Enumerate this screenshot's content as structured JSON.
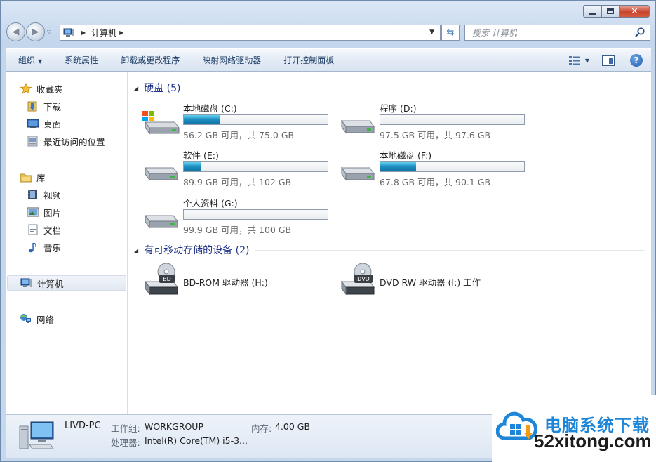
{
  "window": {
    "close_glyph": "✕"
  },
  "address": {
    "crumb": "计算机"
  },
  "search": {
    "placeholder": "搜索 计算机"
  },
  "toolbar": {
    "items": [
      "组织",
      "系统属性",
      "卸载或更改程序",
      "映射网络驱动器",
      "打开控制面板"
    ]
  },
  "sidebar": {
    "favorites": "收藏夹",
    "downloads": "下载",
    "desktop": "桌面",
    "recent": "最近访问的位置",
    "libraries": "库",
    "videos": "视频",
    "pictures": "图片",
    "documents": "文档",
    "music": "音乐",
    "computer": "计算机",
    "network": "网络"
  },
  "groups": {
    "hard_disks": "硬盘 (5)",
    "removable": "有可移动存储的设备 (2)"
  },
  "drives": [
    {
      "name": "本地磁盘 (C:)",
      "info": "56.2 GB 可用，共 75.0 GB",
      "used_fraction": 0.25,
      "system": true
    },
    {
      "name": "程序 (D:)",
      "info": "97.5 GB 可用，共 97.6 GB",
      "used_fraction": 0.001,
      "system": false
    },
    {
      "name": "软件 (E:)",
      "info": "89.9 GB 可用，共 102 GB",
      "used_fraction": 0.12,
      "system": false
    },
    {
      "name": "本地磁盘 (F:)",
      "info": "67.8 GB 可用，共 90.1 GB",
      "used_fraction": 0.25,
      "system": false
    },
    {
      "name": "个人资料 (G:)",
      "info": "99.9 GB 可用，共 100 GB",
      "used_fraction": 0.001,
      "system": false
    }
  ],
  "removable": [
    {
      "name": "BD-ROM 驱动器 (H:)",
      "badge": "BD"
    },
    {
      "name": "DVD RW 驱动器 (I:) 工作",
      "badge": "DVD"
    }
  ],
  "details": {
    "pc_name": "LIVD-PC",
    "workgroup_label": "工作组:",
    "workgroup": "WORKGROUP",
    "memory_label": "内存:",
    "memory": "4.00 GB",
    "cpu_label": "处理器:",
    "cpu": "Intel(R) Core(TM) i5-3..."
  },
  "watermark": {
    "line1": "电脑系统下载",
    "line2": "52xitong.com"
  },
  "colors": {
    "accent": "#1d86d9",
    "bar_fill": "#1c8bbd",
    "group_title": "#1e3287"
  }
}
